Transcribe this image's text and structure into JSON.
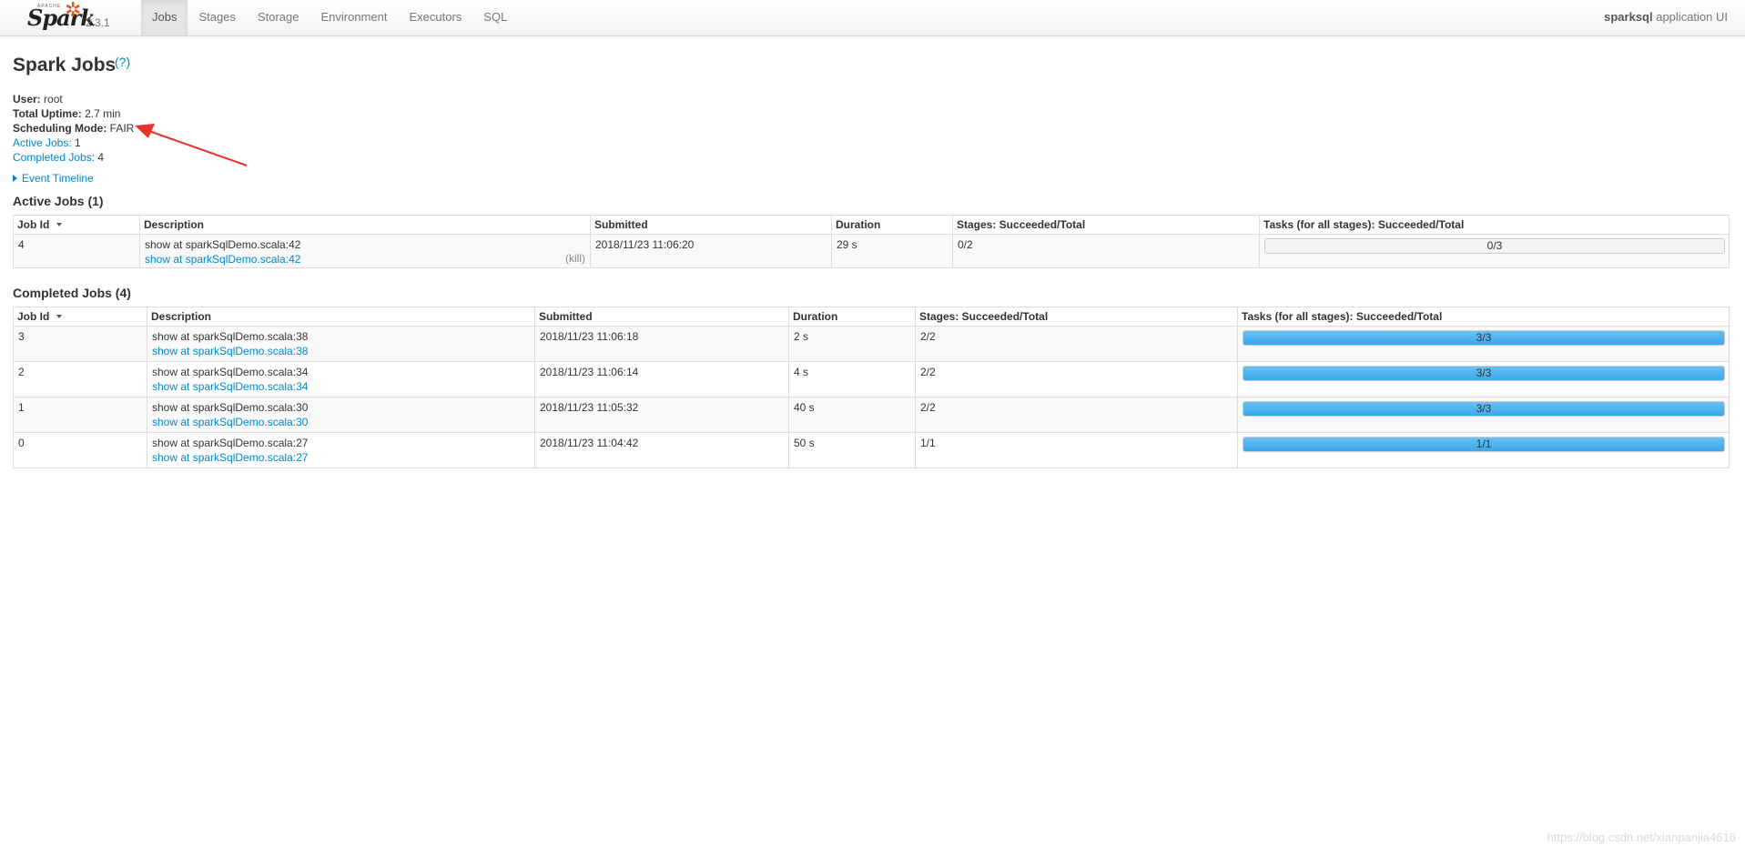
{
  "navbar": {
    "brand_small": "APACHE",
    "brand_word": "Spark",
    "version": "2.3.1",
    "tabs": [
      "Jobs",
      "Stages",
      "Storage",
      "Environment",
      "Executors",
      "SQL"
    ],
    "app_name": "sparksql",
    "app_suffix": " application UI"
  },
  "page": {
    "title": "Spark Jobs",
    "help": "(?)"
  },
  "summary": {
    "user_label": "User:",
    "user_value": " root",
    "uptime_label": "Total Uptime:",
    "uptime_value": " 2.7 min",
    "mode_label": "Scheduling Mode:",
    "mode_value": " FAIR",
    "active_label": "Active Jobs:",
    "active_value": " 1",
    "completed_label": "Completed Jobs:",
    "completed_value": " 4"
  },
  "timeline_link": "Event Timeline",
  "active": {
    "title": "Active Jobs (1)",
    "headers": [
      "Job Id",
      "Description",
      "Submitted",
      "Duration",
      "Stages: Succeeded/Total",
      "Tasks (for all stages): Succeeded/Total"
    ],
    "rows": [
      {
        "id": "4",
        "desc": "show at sparkSqlDemo.scala:42",
        "link": "show at sparkSqlDemo.scala:42",
        "kill": "(kill)",
        "submitted": "2018/11/23 11:06:20",
        "duration": "29 s",
        "stages": "0/2",
        "tasks": "0/3",
        "progress": 0
      }
    ]
  },
  "completed": {
    "title": "Completed Jobs (4)",
    "headers": [
      "Job Id",
      "Description",
      "Submitted",
      "Duration",
      "Stages: Succeeded/Total",
      "Tasks (for all stages): Succeeded/Total"
    ],
    "rows": [
      {
        "id": "3",
        "desc": "show at sparkSqlDemo.scala:38",
        "link": "show at sparkSqlDemo.scala:38",
        "submitted": "2018/11/23 11:06:18",
        "duration": "2 s",
        "stages": "2/2",
        "tasks": "3/3",
        "progress": 1
      },
      {
        "id": "2",
        "desc": "show at sparkSqlDemo.scala:34",
        "link": "show at sparkSqlDemo.scala:34",
        "submitted": "2018/11/23 11:06:14",
        "duration": "4 s",
        "stages": "2/2",
        "tasks": "3/3",
        "progress": 1
      },
      {
        "id": "1",
        "desc": "show at sparkSqlDemo.scala:30",
        "link": "show at sparkSqlDemo.scala:30",
        "submitted": "2018/11/23 11:05:32",
        "duration": "40 s",
        "stages": "2/2",
        "tasks": "3/3",
        "progress": 1
      },
      {
        "id": "0",
        "desc": "show at sparkSqlDemo.scala:27",
        "link": "show at sparkSqlDemo.scala:27",
        "submitted": "2018/11/23 11:04:42",
        "duration": "50 s",
        "stages": "1/1",
        "tasks": "1/1",
        "progress": 1
      }
    ]
  },
  "annotation_color": "#e8322b",
  "watermark": "https://blog.csdn.net/xianpanjia4616"
}
